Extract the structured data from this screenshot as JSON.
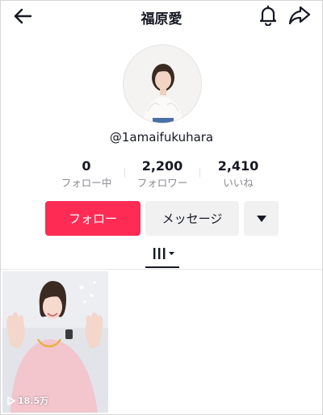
{
  "header": {
    "title": "福原愛"
  },
  "profile": {
    "handle": "@1amaifukuhara"
  },
  "stats": [
    {
      "value": "0",
      "label": "フォロー中"
    },
    {
      "value": "2,200",
      "label": "フォロワー"
    },
    {
      "value": "2,410",
      "label": "いいね"
    }
  ],
  "actions": {
    "follow_label": "フォロー",
    "message_label": "メッセージ"
  },
  "videos": [
    {
      "views": "18.5万"
    }
  ],
  "colors": {
    "accent": "#fe2c55",
    "secondary_button": "#f1f1f2",
    "text": "#161823",
    "muted": "#8a8b91"
  }
}
